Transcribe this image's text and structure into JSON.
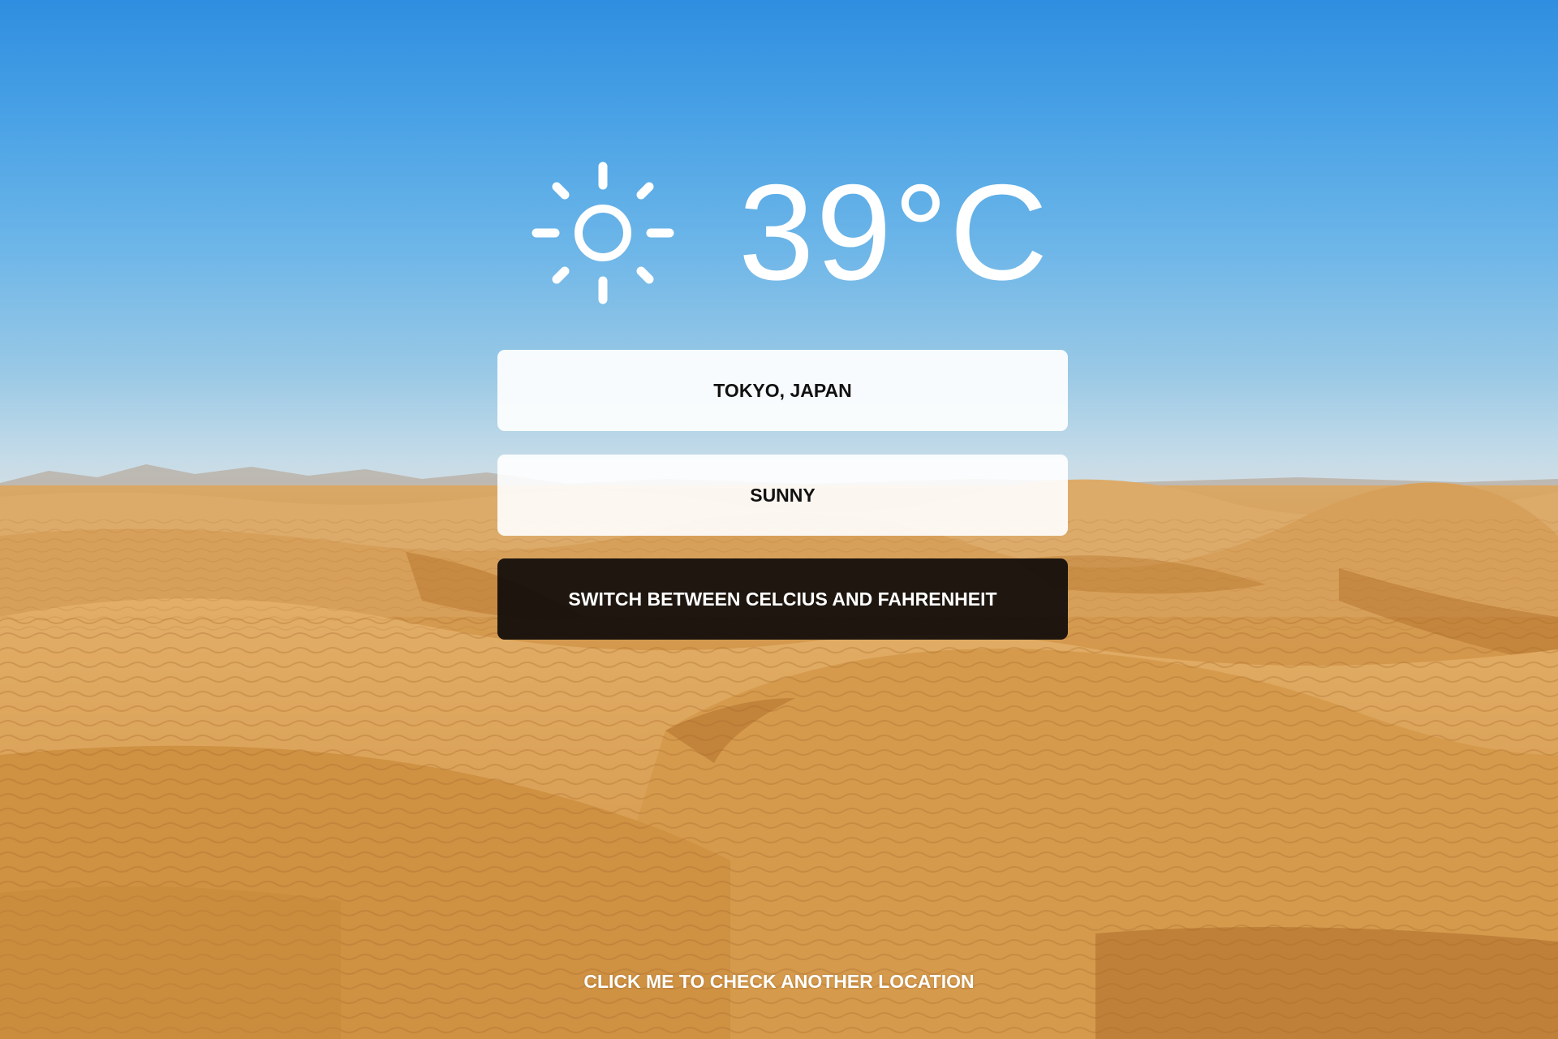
{
  "weather": {
    "icon": "sun-icon",
    "temperature": "39°C",
    "location": "TOKYO, JAPAN",
    "condition": "SUNNY"
  },
  "actions": {
    "switch_units_label": "SWITCH BETWEEN CELCIUS AND FAHRENHEIT",
    "check_location_label": "CLICK ME TO CHECK ANOTHER LOCATION"
  },
  "colors": {
    "sky_top": "#2f8ee0",
    "sky_horizon": "#d9dfe2",
    "sand": "#d9a055",
    "panel_light": "#ffffff",
    "panel_dark": "#100c0a"
  }
}
